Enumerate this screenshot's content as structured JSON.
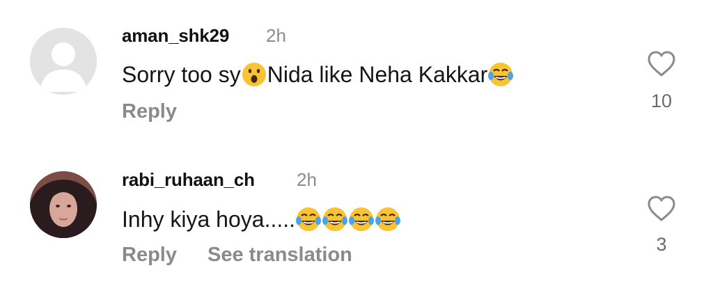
{
  "comments": [
    {
      "username": "aman_shk29",
      "time": "2h",
      "text_parts": [
        "Sorry too sy ",
        "Nida like Neha Kakkar "
      ],
      "emojis": [
        "astonished-face-emoji",
        "tears-of-joy-emoji"
      ],
      "reply_label": "Reply",
      "like_count": "10"
    },
    {
      "username": "rabi_ruhaan_ch",
      "time": "2h",
      "text_parts": [
        "Inhy kiya hoya....."
      ],
      "emojis": [
        "tears-of-joy-emoji",
        "tears-of-joy-emoji",
        "tears-of-joy-emoji",
        "tears-of-joy-emoji"
      ],
      "reply_label": "Reply",
      "translation_label": "See translation",
      "like_count": "3"
    }
  ]
}
